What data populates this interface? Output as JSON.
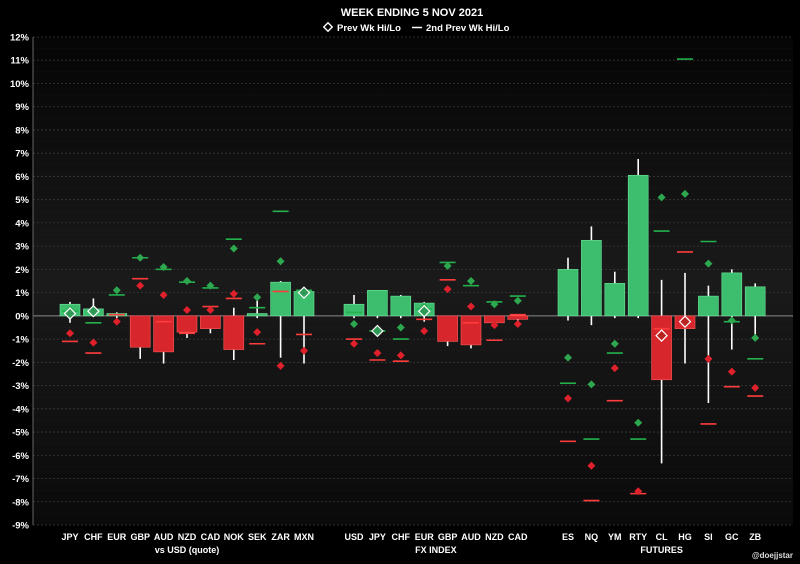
{
  "chart_data": {
    "type": "bar",
    "title": "WEEK ENDING  5 NOV 2021",
    "legend": {
      "placement": "top-center",
      "entries": [
        {
          "label": "Prev Wk Hi/Lo",
          "marker": "diamond"
        },
        {
          "label": "2nd Prev Wk Hi/Lo",
          "marker": "line"
        }
      ]
    },
    "ylim": [
      -9,
      12
    ],
    "yticks": [
      "12%",
      "11%",
      "10%",
      "9%",
      "8%",
      "7%",
      "6%",
      "5%",
      "4%",
      "3%",
      "2%",
      "1%",
      "0%",
      "-1%",
      "-2%",
      "-3%",
      "-4%",
      "-5%",
      "-6%",
      "-7%",
      "-8%",
      "-9%"
    ],
    "grid": true,
    "colors": {
      "up": "#3cbe6e",
      "down": "#d7262c",
      "prev_hi_up": "#2da84e",
      "prev_lo_down": "#e0202a",
      "line_up": "#22b14c",
      "line_down": "#ff3c3c",
      "background": "#111111"
    },
    "groups": [
      {
        "label": "vs USD (quote)",
        "categories": [
          {
            "name": "JPY",
            "close": 0.5,
            "high": 0.6,
            "low": -0.3,
            "prev_hi": 0.25,
            "prev_lo": -0.75,
            "prev2_hi": 0.2,
            "prev2_lo": -1.1,
            "diamond": 0.1
          },
          {
            "name": "CHF",
            "close": 0.3,
            "high": 0.75,
            "low": -0.05,
            "prev_hi": 0.2,
            "prev_lo": -1.15,
            "prev2_hi": -0.3,
            "prev2_lo": -1.6,
            "diamond": 0.2
          },
          {
            "name": "EUR",
            "close": 0.1,
            "high": 0.15,
            "low": -0.1,
            "prev_hi": 1.1,
            "prev_lo": -0.25,
            "prev2_hi": 0.9,
            "prev2_lo": 0.05
          },
          {
            "name": "GBP",
            "close": -1.35,
            "high": 0.0,
            "low": -1.85,
            "prev_hi": 2.5,
            "prev_lo": 1.3,
            "prev2_hi": 2.5,
            "prev2_lo": 1.6
          },
          {
            "name": "AUD",
            "close": -1.55,
            "high": 0.0,
            "low": -2.05,
            "prev_hi": 2.1,
            "prev_lo": 0.9,
            "prev2_hi": 2.0,
            "prev2_lo": -0.25
          },
          {
            "name": "NZD",
            "close": -0.7,
            "high": 0.0,
            "low": -0.95,
            "prev_hi": 1.5,
            "prev_lo": 0.25,
            "prev2_hi": 1.45,
            "prev2_lo": -0.75
          },
          {
            "name": "CAD",
            "close": -0.55,
            "high": 0.0,
            "low": -0.75,
            "prev_hi": 1.3,
            "prev_lo": 0.25,
            "prev2_hi": 1.2,
            "prev2_lo": 0.4
          },
          {
            "name": "NOK",
            "close": -1.45,
            "high": 0.35,
            "low": -1.9,
            "prev_hi": 2.9,
            "prev_lo": 0.95,
            "prev2_hi": 3.3,
            "prev2_lo": 0.75
          },
          {
            "name": "SEK",
            "close": 0.1,
            "high": 0.7,
            "low": -0.1,
            "prev_hi": 0.8,
            "prev_lo": -0.7,
            "prev2_hi": 0.35,
            "prev2_lo": -1.2
          },
          {
            "name": "ZAR",
            "close": 1.45,
            "high": 1.5,
            "low": -1.8,
            "prev_hi": 2.35,
            "prev_lo": -2.15,
            "prev2_hi": 4.5,
            "prev2_lo": 1.05
          },
          {
            "name": "MXN",
            "close": 1.05,
            "high": 1.15,
            "low": -2.05,
            "prev_hi": 1.0,
            "prev_lo": -1.5,
            "prev2_hi": 1.1,
            "prev2_lo": -0.8,
            "diamond": 1.0
          }
        ]
      },
      {
        "label": "FX INDEX",
        "categories": [
          {
            "name": "USD",
            "close": 0.5,
            "high": 0.9,
            "low": -0.1,
            "prev_hi": -0.35,
            "prev_lo": -1.2,
            "prev2_hi": 0.15,
            "prev2_lo": -1.0
          },
          {
            "name": "JPY",
            "close": 1.1,
            "high": 1.1,
            "low": -0.1,
            "prev_hi": -0.65,
            "prev_lo": -1.6,
            "prev2_hi": -0.65,
            "prev2_lo": -1.9,
            "diamond": -0.65
          },
          {
            "name": "CHF",
            "close": 0.85,
            "high": 0.9,
            "low": -0.1,
            "prev_hi": -0.5,
            "prev_lo": -1.7,
            "prev2_hi": -1.0,
            "prev2_lo": -1.95
          },
          {
            "name": "EUR",
            "close": 0.55,
            "high": 0.6,
            "low": -0.25,
            "prev_hi": 0.4,
            "prev_lo": -0.65,
            "prev2_hi": 0.3,
            "prev2_lo": -0.15,
            "diamond": 0.2
          },
          {
            "name": "GBP",
            "close": -1.1,
            "high": 0.0,
            "low": -1.3,
            "prev_hi": 2.15,
            "prev_lo": 1.15,
            "prev2_hi": 2.3,
            "prev2_lo": 1.55
          },
          {
            "name": "AUD",
            "close": -1.25,
            "high": 0.0,
            "low": -1.4,
            "prev_hi": 1.5,
            "prev_lo": 0.4,
            "prev2_hi": 1.3,
            "prev2_lo": -0.3
          },
          {
            "name": "NZD",
            "close": -0.3,
            "high": 0.0,
            "low": -0.5,
            "prev_hi": 0.5,
            "prev_lo": -0.4,
            "prev2_hi": 0.6,
            "prev2_lo": -1.05
          },
          {
            "name": "CAD",
            "close": -0.15,
            "high": 0.0,
            "low": -0.2,
            "prev_hi": 0.65,
            "prev_lo": -0.35,
            "prev2_hi": 0.85,
            "prev2_lo": 0.05
          }
        ]
      },
      {
        "label": "FUTURES",
        "categories": [
          {
            "name": "ES",
            "close": 2.0,
            "high": 2.5,
            "low": -0.2,
            "prev_hi": -1.8,
            "prev_lo": -3.55,
            "prev2_hi": -2.9,
            "prev2_lo": -5.4
          },
          {
            "name": "NQ",
            "close": 3.25,
            "high": 3.85,
            "low": -0.4,
            "prev_hi": -2.95,
            "prev_lo": -6.45,
            "prev2_hi": -5.3,
            "prev2_lo": -7.95
          },
          {
            "name": "YM",
            "close": 1.4,
            "high": 1.9,
            "low": -0.1,
            "prev_hi": -1.2,
            "prev_lo": -2.25,
            "prev2_hi": -1.6,
            "prev2_lo": -3.65
          },
          {
            "name": "RTY",
            "close": 6.05,
            "high": 6.75,
            "low": -0.1,
            "prev_hi": -4.6,
            "prev_lo": -7.55,
            "prev2_hi": -5.3,
            "prev2_lo": -7.65
          },
          {
            "name": "CL",
            "close": -2.75,
            "high": 1.55,
            "low": -6.35,
            "prev_hi": 5.1,
            "prev_lo": -0.8,
            "prev2_hi": 3.65,
            "prev2_lo": -0.55,
            "diamond": -0.85
          },
          {
            "name": "HG",
            "close": -0.55,
            "high": 1.85,
            "low": -2.05,
            "prev_hi": 5.25,
            "prev_lo": -0.25,
            "prev2_hi": 11.05,
            "prev2_lo": 2.75,
            "diamond": -0.25
          },
          {
            "name": "SI",
            "close": 0.85,
            "high": 1.3,
            "low": -3.75,
            "prev_hi": 2.25,
            "prev_lo": -1.85,
            "prev2_hi": 3.2,
            "prev2_lo": -4.65
          },
          {
            "name": "GC",
            "close": 1.85,
            "high": 2.0,
            "low": -1.45,
            "prev_hi": -0.2,
            "prev_lo": -2.4,
            "prev2_hi": -0.25,
            "prev2_lo": -3.05
          },
          {
            "name": "ZB",
            "close": 1.25,
            "high": 1.4,
            "low": -0.8,
            "prev_hi": -0.95,
            "prev_lo": -3.1,
            "prev2_hi": -1.85,
            "prev2_lo": -3.45
          }
        ]
      }
    ],
    "watermark": "@doejjstar"
  }
}
